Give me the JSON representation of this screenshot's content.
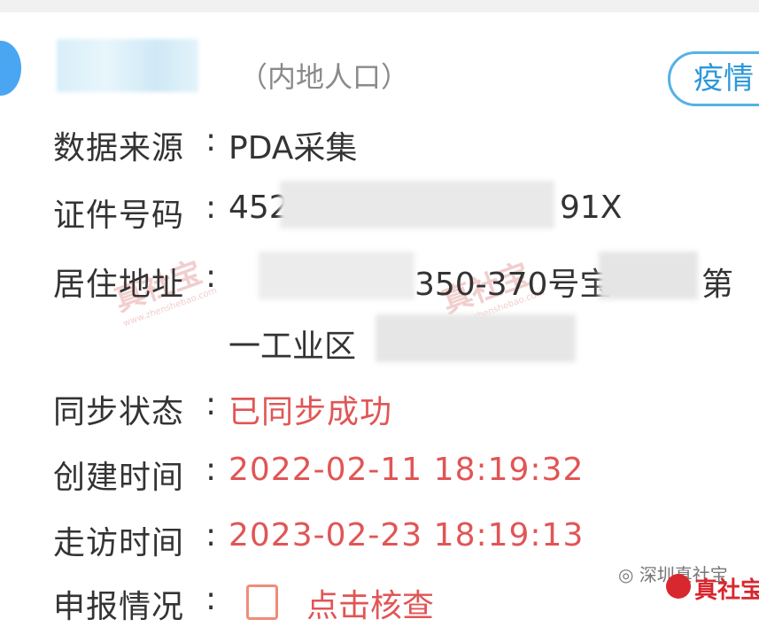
{
  "header": {
    "category": "（内地人口）",
    "epidemic_button": "疫情"
  },
  "fields": [
    {
      "label": "数据来源",
      "colon": ":",
      "value": "PDA采集"
    },
    {
      "label": "证件号码",
      "colon": ":",
      "value_start": "452",
      "value_end": "91X"
    },
    {
      "label": "居住地址",
      "colon": ":",
      "value_mid": "350-370号宝",
      "value_tail": "第",
      "value_line2": "一工业区"
    },
    {
      "label": "同步状态",
      "colon": ":",
      "value": "已同步成功"
    },
    {
      "label": "创建时间",
      "colon": ":",
      "value": "2022-02-11 18:19:32"
    },
    {
      "label": "走访时间",
      "colon": ":",
      "value": "2023-02-23 18:19:13"
    },
    {
      "label": "申报情况",
      "colon": ":",
      "value": "点击核查"
    }
  ],
  "watermark": {
    "text": "真社宝",
    "url": "www.zhenshebao.com"
  },
  "footer": {
    "wechat": "深圳真社宝",
    "brand": "真社宝"
  },
  "colors": {
    "accent_blue": "#55b2e4",
    "status_red": "#e15555",
    "brand_red": "#d9272e"
  }
}
